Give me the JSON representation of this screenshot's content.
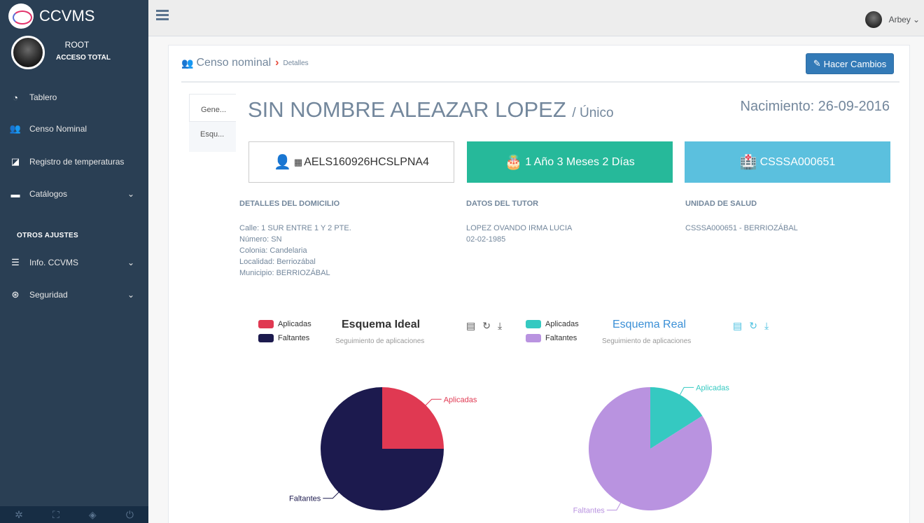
{
  "sidebar": {
    "brand": "CCVMS",
    "profile": {
      "role": "ROOT",
      "access": "ACCESO TOTAL"
    },
    "items": [
      {
        "label": "Tablero",
        "icon": "dashboard-icon"
      },
      {
        "label": "Censo Nominal",
        "icon": "users-icon"
      },
      {
        "label": "Registro de temperaturas",
        "icon": "share-icon"
      },
      {
        "label": "Catálogos",
        "icon": "drawer-icon"
      }
    ],
    "section_label": "OTROS AJUSTES",
    "extra_items": [
      {
        "label": "Info. CCVMS",
        "icon": "server-icon"
      },
      {
        "label": "Seguridad",
        "icon": "accessibility-icon"
      }
    ]
  },
  "topbar": {
    "user_name": "Arbey"
  },
  "breadcrumb": {
    "main": "Censo nominal",
    "sub": "Detalles"
  },
  "edit_button": "Hacer Cambios",
  "tabs": [
    "Gene...",
    "Esqu..."
  ],
  "person": {
    "name": "SIN NOMBRE ALEAZAR LOPEZ",
    "name_suffix": "/ Único",
    "birth": "Nacimiento: 26-09-2016"
  },
  "cards": {
    "curp": "AELS160926HCSLPNA4",
    "age": "1 Año 3 Meses 2 Días",
    "clues": "CSSSA000651"
  },
  "details": {
    "domicilio_title": "DETALLES DEL DOMICILIO",
    "domicilio_lines": [
      "Calle: 1 SUR ENTRE 1 Y 2 PTE.",
      "Número: SN",
      "Colonia: Candelaria",
      "Localidad: Berriozábal",
      "Municipio: BERRIOZÁBAL"
    ],
    "tutor_title": "DATOS DEL TUTOR",
    "tutor_lines": [
      "LOPEZ OVANDO IRMA LUCIA",
      "02-02-1985"
    ],
    "unidad_title": "UNIDAD DE SALUD",
    "unidad_lines": [
      "CSSSA000651 - BERRIOZÁBAL"
    ]
  },
  "chart_data": [
    {
      "type": "pie",
      "title": "Esquema Ideal",
      "subtitle": "Seguimiento de aplicaciones",
      "categories": [
        "Aplicadas",
        "Faltantes"
      ],
      "values": [
        25,
        75
      ],
      "colors": [
        "#e03952",
        "#1c1a4e"
      ]
    },
    {
      "type": "pie",
      "title": "Esquema Real",
      "subtitle": "Seguimiento de aplicaciones",
      "categories": [
        "Aplicadas",
        "Faltantes"
      ],
      "values": [
        16,
        84
      ],
      "colors": [
        "#35c9c1",
        "#b993e0"
      ]
    }
  ]
}
